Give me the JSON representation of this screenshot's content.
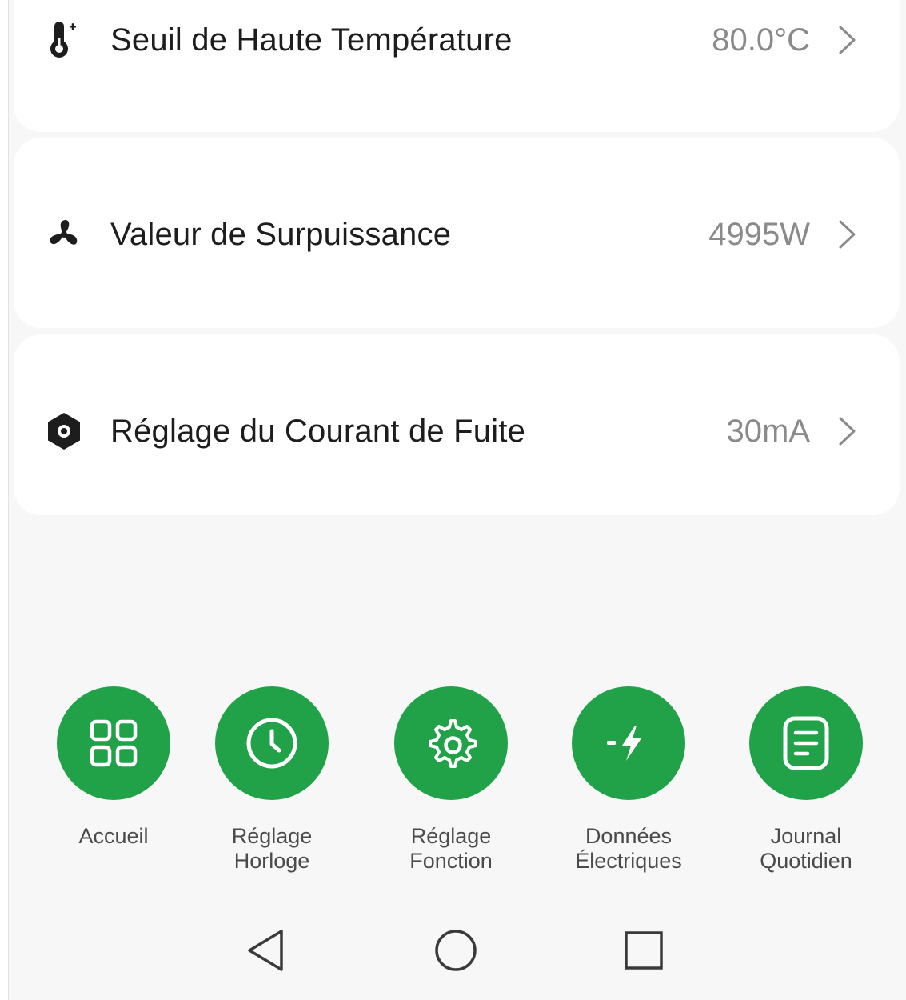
{
  "settings": [
    {
      "label": "Seuil de Haute Température",
      "value": "80.0°C",
      "icon": "thermometer-icon"
    },
    {
      "label": "Valeur de Surpuissance",
      "value": "4995W",
      "icon": "fan-icon"
    },
    {
      "label": "Réglage du Courant de Fuite",
      "value": "30mA",
      "icon": "leak-current-icon"
    }
  ],
  "nav": [
    {
      "label_line1": "Accueil",
      "label_line2": "",
      "icon": "grid-icon"
    },
    {
      "label_line1": "Réglage",
      "label_line2": "Horloge",
      "icon": "clock-icon"
    },
    {
      "label_line1": "Réglage",
      "label_line2": "Fonction",
      "icon": "gear-icon"
    },
    {
      "label_line1": "Données",
      "label_line2": "Électriques",
      "icon": "lightning-icon"
    },
    {
      "label_line1": "Journal",
      "label_line2": "Quotidien",
      "icon": "document-icon"
    }
  ],
  "colors": {
    "accent": "#21a249",
    "background": "#f7f7f7",
    "card": "#ffffff",
    "value_text": "#8a8a8a"
  },
  "system_nav": [
    "back-icon",
    "home-icon",
    "recents-icon"
  ]
}
